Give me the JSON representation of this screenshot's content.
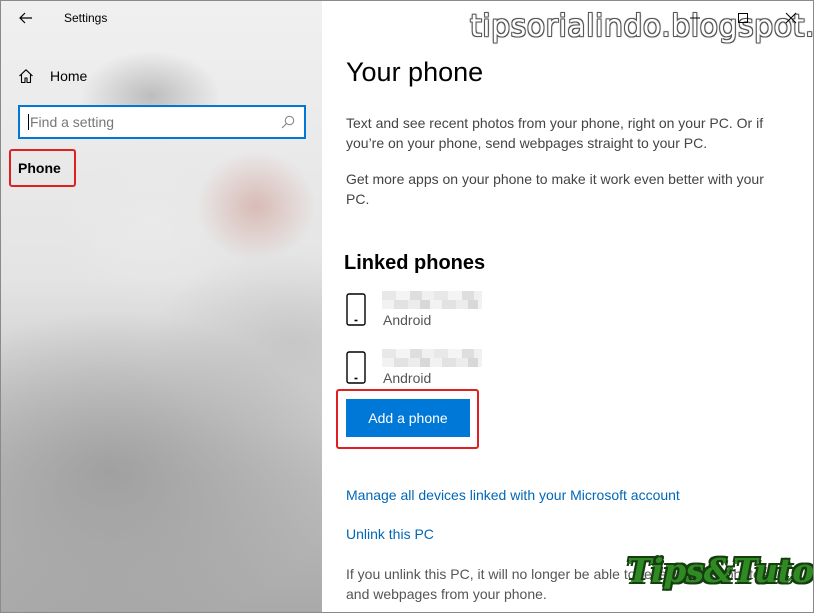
{
  "window": {
    "title": "Settings"
  },
  "sidebar": {
    "home_label": "Home",
    "search_placeholder": "Find a setting",
    "active_item_label": "Phone"
  },
  "main": {
    "title": "Your phone",
    "description_1": "Text and see recent photos from your phone, right on your PC. Or if you’re on your phone, send webpages straight to your PC.",
    "description_2": "Get more apps on your phone to make it work even better with your PC.",
    "linked_phones_heading": "Linked phones",
    "devices": [
      {
        "name": "",
        "os": "Android",
        "icon": "smartphone-icon"
      },
      {
        "name": "",
        "os": "Android",
        "icon": "smartphone-icon"
      }
    ],
    "add_phone_label": "Add a phone",
    "manage_link": "Manage all devices linked with your Microsoft account",
    "unlink_link": "Unlink this PC",
    "footnote": "If you unlink this PC, it will no longer be able to receive texts, photos, and webpages from your phone."
  },
  "overlays": {
    "watermark_text": "tipsorialindo.blogspot.com",
    "logo_text": "Tips&Tutorial"
  },
  "colors": {
    "accent": "#0078d7",
    "link": "#0067b8",
    "highlight_box": "#e02020"
  }
}
